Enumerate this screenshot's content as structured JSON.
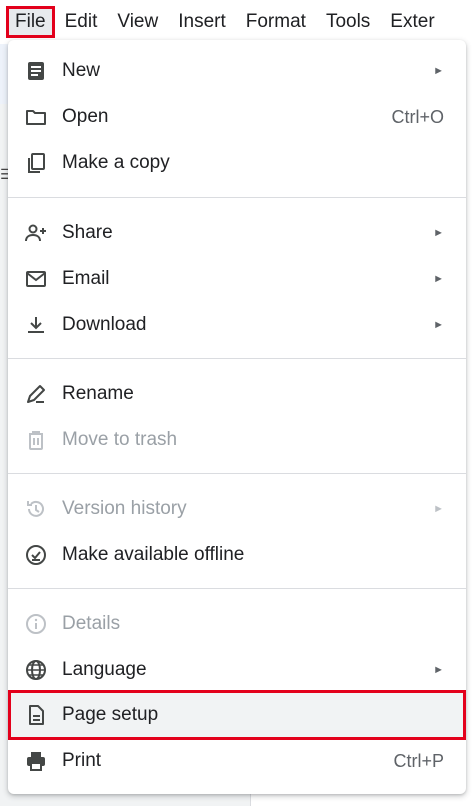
{
  "menubar": {
    "items": [
      "File",
      "Edit",
      "View",
      "Insert",
      "Format",
      "Tools",
      "Exter"
    ]
  },
  "file_menu": {
    "groups": [
      [
        {
          "label": "New",
          "icon": "document-icon",
          "submenu": true,
          "disabled": false
        },
        {
          "label": "Open",
          "icon": "folder-icon",
          "shortcut": "Ctrl+O",
          "disabled": false
        },
        {
          "label": "Make a copy",
          "icon": "copy-icon",
          "disabled": false
        }
      ],
      [
        {
          "label": "Share",
          "icon": "person-add-icon",
          "submenu": true,
          "disabled": false
        },
        {
          "label": "Email",
          "icon": "mail-icon",
          "submenu": true,
          "disabled": false
        },
        {
          "label": "Download",
          "icon": "download-icon",
          "submenu": true,
          "disabled": false
        }
      ],
      [
        {
          "label": "Rename",
          "icon": "rename-icon",
          "disabled": false
        },
        {
          "label": "Move to trash",
          "icon": "trash-icon",
          "disabled": true
        }
      ],
      [
        {
          "label": "Version history",
          "icon": "history-icon",
          "submenu": true,
          "disabled": true
        },
        {
          "label": "Make available offline",
          "icon": "offline-check-icon",
          "disabled": false
        }
      ],
      [
        {
          "label": "Details",
          "icon": "info-icon",
          "disabled": true
        },
        {
          "label": "Language",
          "icon": "globe-icon",
          "submenu": true,
          "disabled": false
        },
        {
          "label": "Page setup",
          "icon": "page-icon",
          "disabled": false,
          "highlighted": true
        },
        {
          "label": "Print",
          "icon": "print-icon",
          "shortcut": "Ctrl+P",
          "disabled": false
        }
      ]
    ],
    "submenu_arrow": "►"
  },
  "colors": {
    "highlight_border": "#e3001b",
    "disabled_text": "#9aa0a6",
    "text": "#202124"
  }
}
